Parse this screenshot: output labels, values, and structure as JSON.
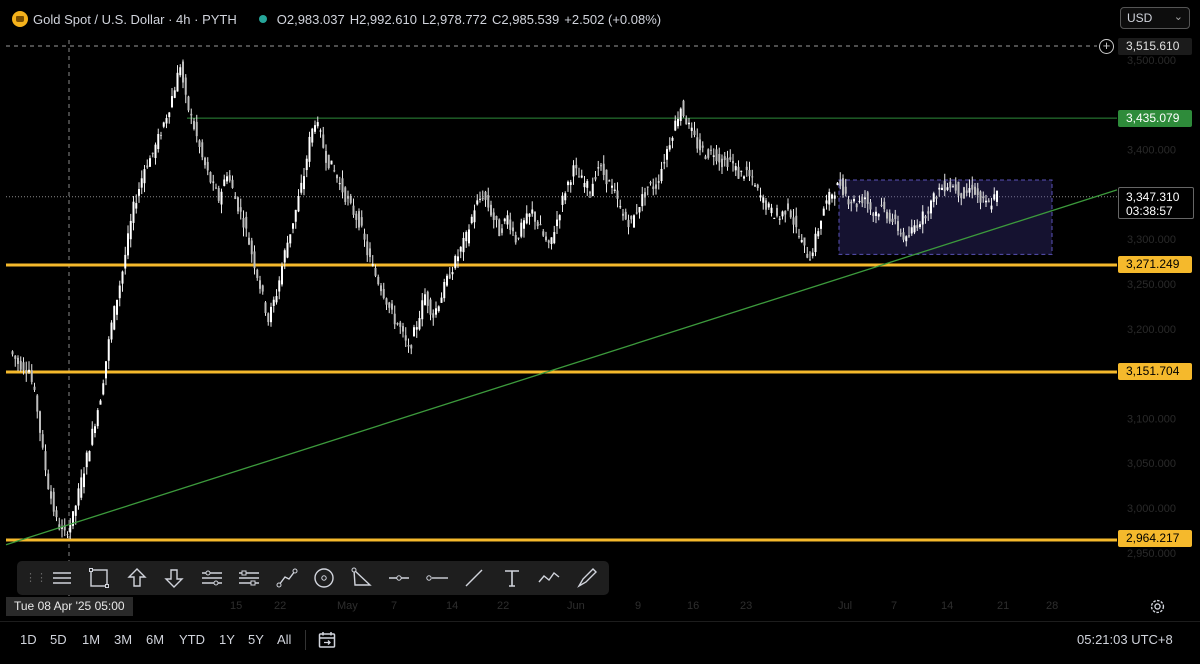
{
  "header": {
    "symbol_title": "Gold Spot / U.S. Dollar · 4h · PYTH",
    "open_label": "O",
    "open": "2,983.037",
    "high_label": "H",
    "high": "2,992.610",
    "low_label": "L",
    "low": "2,978.772",
    "close_label": "C",
    "close": "2,985.539",
    "change": "+2.502 (+0.08%)",
    "currency": "USD"
  },
  "chart_data": {
    "type": "candlestick",
    "ylim": [
      2930,
      3540
    ],
    "start_date": "Apr 08 '25",
    "x_tick_labels": [
      "15",
      "22",
      "May",
      "7",
      "14",
      "22",
      "Jun",
      "9",
      "16",
      "23",
      "Jul",
      "7",
      "14",
      "21",
      "28"
    ],
    "y_tick_labels": [
      "3,500.000",
      "3,400.000",
      "3,350.000",
      "3,300.000",
      "3,250.000",
      "3,200.000",
      "3,150.000",
      "3,100.000",
      "3,050.000",
      "3,000.000",
      "2,950.000"
    ],
    "horizontal_levels": [
      {
        "label": "3,515.610",
        "value": 3515.61,
        "style": "dashed"
      },
      {
        "label": "3,435.079",
        "value": 3435.079,
        "color": "#2e8b3a"
      },
      {
        "label": "3,271.249",
        "value": 3271.249,
        "color": "#f5b92c"
      },
      {
        "label": "3,151.704",
        "value": 3151.704,
        "color": "#f5b92c"
      },
      {
        "label": "2,964.217",
        "value": 2964.217,
        "color": "#f5b92c"
      }
    ],
    "trendline": {
      "color": "#3c9a3c",
      "from": {
        "date": "Apr 07 '25",
        "value": 2959
      },
      "to": {
        "date": "Jul 28 '25",
        "value": 3355
      }
    },
    "rectangle": {
      "from": "Jun 30 '25",
      "to": "Jul 24 '25",
      "top": 3366,
      "bottom": 3283
    },
    "current_price": "3,347.310",
    "countdown": "03:38:57",
    "crosshair": {
      "date": "Apr 08 '25",
      "value": 3515.61
    },
    "price_path": [
      [
        2,
        3175
      ],
      [
        5,
        3162
      ],
      [
        9,
        3155
      ],
      [
        12,
        3110
      ],
      [
        14,
        3062
      ],
      [
        16,
        3025
      ],
      [
        19,
        2985
      ],
      [
        22,
        2970
      ],
      [
        25,
        2990
      ],
      [
        28,
        3030
      ],
      [
        31,
        3070
      ],
      [
        35,
        3125
      ],
      [
        39,
        3205
      ],
      [
        43,
        3265
      ],
      [
        47,
        3335
      ],
      [
        51,
        3380
      ],
      [
        54,
        3395
      ],
      [
        57,
        3420
      ],
      [
        60,
        3448
      ],
      [
        62,
        3470
      ],
      [
        64,
        3495
      ],
      [
        66,
        3455
      ],
      [
        69,
        3425
      ],
      [
        72,
        3390
      ],
      [
        75,
        3365
      ],
      [
        78,
        3345
      ],
      [
        81,
        3375
      ],
      [
        84,
        3345
      ],
      [
        87,
        3320
      ],
      [
        90,
        3285
      ],
      [
        93,
        3248
      ],
      [
        96,
        3210
      ],
      [
        99,
        3240
      ],
      [
        102,
        3285
      ],
      [
        106,
        3332
      ],
      [
        109,
        3372
      ],
      [
        111,
        3410
      ],
      [
        113,
        3433
      ],
      [
        115,
        3415
      ],
      [
        117,
        3392
      ],
      [
        120,
        3375
      ],
      [
        123,
        3355
      ],
      [
        126,
        3335
      ],
      [
        129,
        3320
      ],
      [
        132,
        3285
      ],
      [
        135,
        3260
      ],
      [
        138,
        3240
      ],
      [
        141,
        3215
      ],
      [
        144,
        3200
      ],
      [
        147,
        3175
      ],
      [
        150,
        3205
      ],
      [
        153,
        3238
      ],
      [
        156,
        3215
      ],
      [
        159,
        3238
      ],
      [
        162,
        3262
      ],
      [
        165,
        3282
      ],
      [
        168,
        3302
      ],
      [
        171,
        3335
      ],
      [
        174,
        3350
      ],
      [
        177,
        3330
      ],
      [
        180,
        3308
      ],
      [
        183,
        3325
      ],
      [
        186,
        3300
      ],
      [
        189,
        3318
      ],
      [
        192,
        3330
      ],
      [
        195,
        3310
      ],
      [
        198,
        3290
      ],
      [
        201,
        3322
      ],
      [
        204,
        3355
      ],
      [
        207,
        3378
      ],
      [
        210,
        3365
      ],
      [
        213,
        3355
      ],
      [
        216,
        3382
      ],
      [
        219,
        3368
      ],
      [
        222,
        3350
      ],
      [
        225,
        3325
      ],
      [
        228,
        3318
      ],
      [
        231,
        3340
      ],
      [
        234,
        3358
      ],
      [
        237,
        3360
      ],
      [
        240,
        3390
      ],
      [
        243,
        3420
      ],
      [
        246,
        3448
      ],
      [
        249,
        3425
      ],
      [
        252,
        3405
      ],
      [
        255,
        3395
      ],
      [
        258,
        3398
      ],
      [
        261,
        3386
      ],
      [
        264,
        3388
      ],
      [
        267,
        3372
      ],
      [
        270,
        3375
      ],
      [
        273,
        3358
      ],
      [
        276,
        3342
      ],
      [
        279,
        3330
      ],
      [
        282,
        3324
      ],
      [
        285,
        3338
      ],
      [
        288,
        3310
      ],
      [
        291,
        3288
      ],
      [
        293,
        3280
      ],
      [
        295,
        3300
      ],
      [
        298,
        3335
      ],
      [
        301,
        3352
      ],
      [
        304,
        3362
      ],
      [
        307,
        3345
      ],
      [
        310,
        3340
      ],
      [
        313,
        3348
      ],
      [
        316,
        3328
      ],
      [
        319,
        3335
      ],
      [
        322,
        3325
      ],
      [
        325,
        3312
      ],
      [
        328,
        3298
      ],
      [
        331,
        3315
      ],
      [
        334,
        3325
      ],
      [
        337,
        3340
      ],
      [
        340,
        3356
      ],
      [
        343,
        3362
      ],
      [
        346,
        3358
      ],
      [
        349,
        3348
      ],
      [
        352,
        3360
      ],
      [
        355,
        3342
      ],
      [
        358,
        3338
      ],
      [
        361,
        3350
      ]
    ]
  },
  "toolbar": {
    "tools": [
      "horizontal-lines-icon",
      "rectangle-icon",
      "arrow-up-icon",
      "arrow-down-icon",
      "parallel-channel-icon",
      "settings-sliders-icon",
      "path-icon",
      "circle-icon",
      "triangle-icon",
      "horizontal-ray-icon",
      "horizontal-line-icon",
      "trend-line-icon",
      "text-icon",
      "polyline-icon",
      "brush-icon"
    ]
  },
  "footer": {
    "crosshair_time": "Tue 08 Apr '25   05:00",
    "ranges": [
      "1D",
      "5D",
      "1M",
      "3M",
      "6M",
      "YTD",
      "1Y",
      "5Y",
      "All"
    ],
    "clock": "05:21:03 UTC+8"
  }
}
